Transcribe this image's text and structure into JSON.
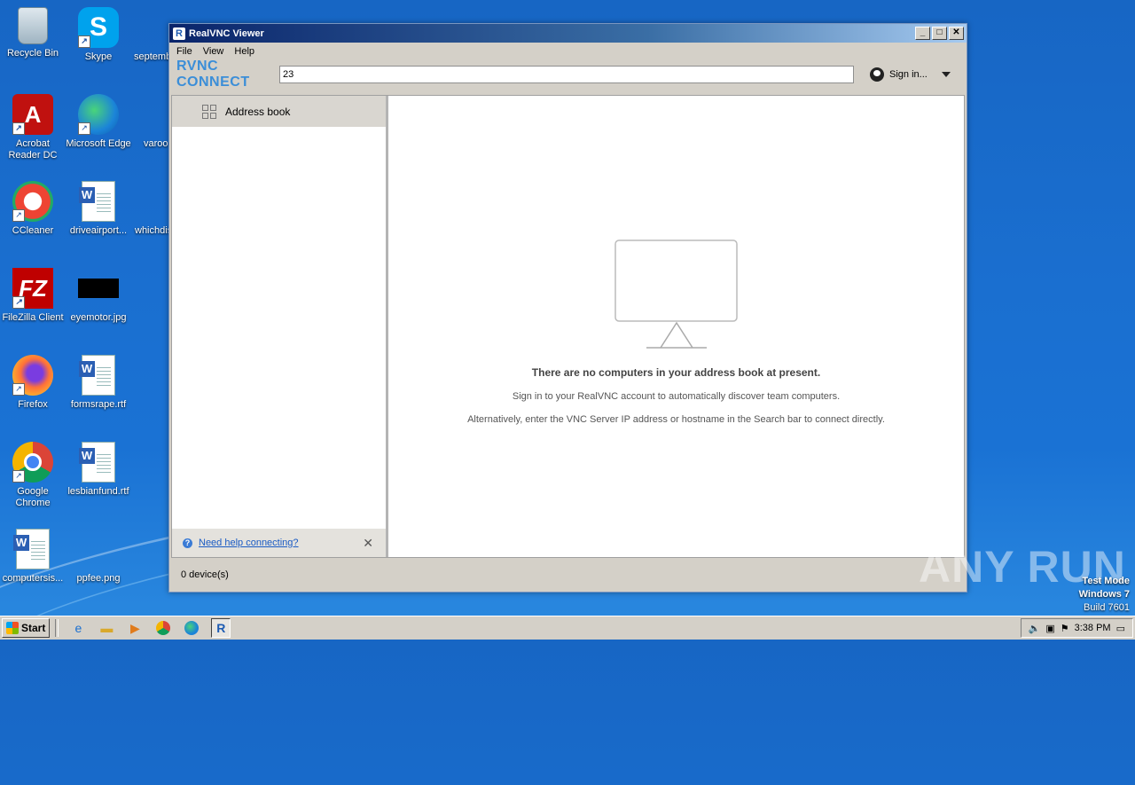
{
  "desktop": {
    "icons": [
      {
        "label": "Recycle Bin"
      },
      {
        "label": "Skype"
      },
      {
        "label": "septemb"
      },
      {
        "label": "Acrobat Reader DC"
      },
      {
        "label": "Microsoft Edge"
      },
      {
        "label": "varoo"
      },
      {
        "label": "CCleaner"
      },
      {
        "label": "driveairport..."
      },
      {
        "label": "whichdis"
      },
      {
        "label": "FileZilla Client"
      },
      {
        "label": "eyemotor.jpg"
      },
      {
        "label": "Firefox"
      },
      {
        "label": "formsrape.rtf"
      },
      {
        "label": "Google Chrome"
      },
      {
        "label": "lesbianfund.rtf"
      },
      {
        "label": "computersis..."
      },
      {
        "label": "ppfee.png"
      }
    ]
  },
  "window": {
    "title": "RealVNC Viewer",
    "menu": [
      "File",
      "View",
      "Help"
    ],
    "brand": "RVNC CONNECT",
    "address_value": "23",
    "signin_label": "Sign in...",
    "sidebar_item": "Address book",
    "help_link": "Need help connecting?",
    "empty_heading": "There are no computers in your address book at present.",
    "empty_line1": "Sign in to your RealVNC account to automatically discover team computers.",
    "empty_line2": "Alternatively, enter the VNC Server IP address or hostname in the Search bar to connect directly.",
    "status": "0 device(s)"
  },
  "watermark": "ANY RUN",
  "testmode": {
    "line1": "Test Mode",
    "line2": "Windows 7",
    "line3": "Build 7601"
  },
  "taskbar": {
    "start": "Start",
    "time": "3:38 PM"
  }
}
